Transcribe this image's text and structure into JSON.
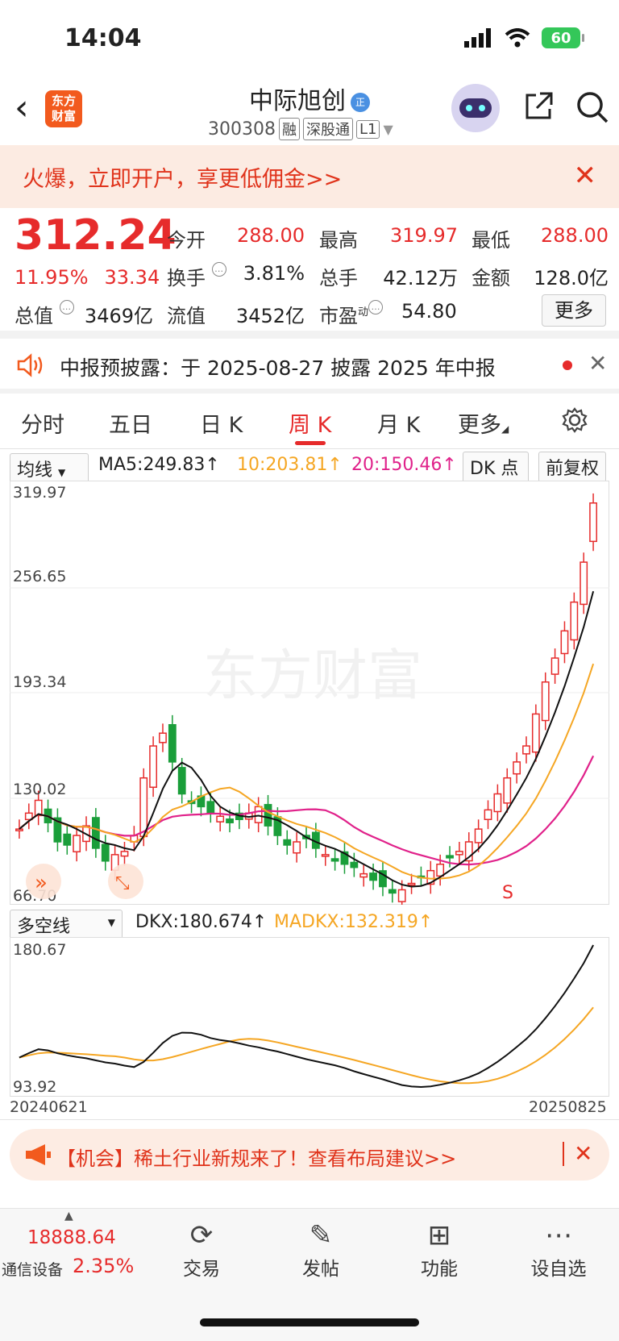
{
  "status": {
    "time": "14:04",
    "battery": "60"
  },
  "header": {
    "logo": [
      "东方",
      "财富"
    ],
    "name": "中际旭创",
    "code": "300308",
    "tags": [
      "融",
      "深股通",
      "L1"
    ]
  },
  "promo": {
    "text": "火爆，立即开户，享更低佣金>>"
  },
  "quote": {
    "price": "312.24",
    "change_pct": "11.95%",
    "change": "33.34",
    "fields": [
      {
        "label": "今开",
        "value": "288.00",
        "color": "red"
      },
      {
        "label": "最高",
        "value": "319.97",
        "color": "red"
      },
      {
        "label": "最低",
        "value": "288.00",
        "color": "red"
      },
      {
        "label": "换手",
        "value": "3.81%",
        "color": "black"
      },
      {
        "label": "总手",
        "value": "42.12万",
        "color": "black"
      },
      {
        "label": "金额",
        "value": "128.0亿",
        "color": "black"
      },
      {
        "label": "总值",
        "value": "3469亿",
        "color": "black"
      },
      {
        "label": "流值",
        "value": "3452亿",
        "color": "black"
      },
      {
        "label": "市盈",
        "value": "54.80",
        "color": "black"
      }
    ],
    "pe_sup": "动",
    "more": "更多"
  },
  "notice": {
    "text": "中报预披露：于 2025-08-27 披露 2025 年中报"
  },
  "tabs": [
    "分时",
    "五日",
    "日 K",
    "周 K",
    "月 K",
    "更多"
  ],
  "active_tab": "周 K",
  "indicators": {
    "ma_select": "均线",
    "ma5": "MA5:249.83↑",
    "ma10": "10:203.81↑",
    "ma20": "20:150.46↑",
    "dk": "DK 点",
    "adjust": "前复权",
    "sub_select": "多空线",
    "dkx": "DKX:180.674↑",
    "madkx": "MADKX:132.319↑"
  },
  "chart_data": [
    {
      "type": "candlestick",
      "y_ticks": [
        "319.97",
        "256.65",
        "193.34",
        "130.02",
        "66.70"
      ],
      "ylim": [
        66.7,
        319.97
      ],
      "signal_label": "S",
      "watermark": "东方财富",
      "colors": {
        "up": "#e62b2b",
        "down": "#1a9e3a",
        "ma5": "#111111",
        "ma10": "#f5a623",
        "ma20": "#e0218a"
      }
    },
    {
      "type": "line",
      "y_ticks": [
        "180.67",
        "93.92"
      ],
      "x_labels": [
        "20240621",
        "20250825"
      ],
      "series": [
        {
          "name": "DKX",
          "color": "#111111"
        },
        {
          "name": "MADKX",
          "color": "#f5a623"
        }
      ]
    }
  ],
  "promo2": {
    "text": "【机会】稀土行业新规来了！查看布局建议>>"
  },
  "bottom_nav": {
    "index_value": "18888.64",
    "index_name": "通信设备",
    "index_pct": "2.35%",
    "items": [
      "交易",
      "发帖",
      "功能",
      "设自选"
    ]
  }
}
